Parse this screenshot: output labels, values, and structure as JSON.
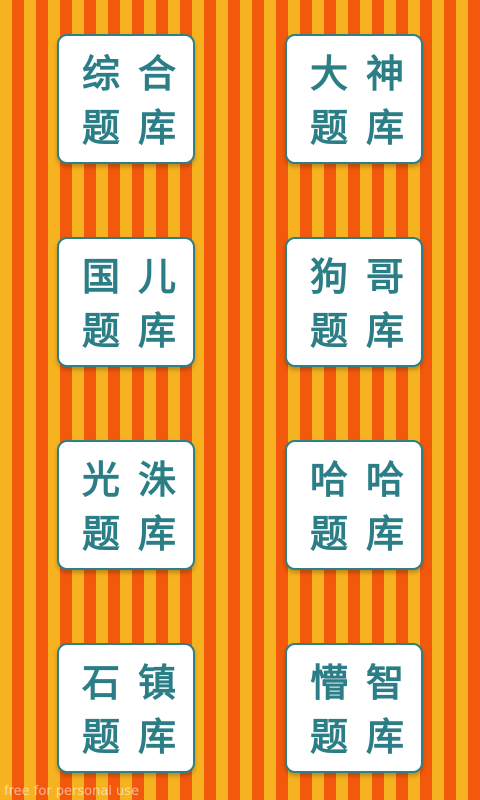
{
  "tiles": [
    {
      "line1": [
        "综",
        "合"
      ],
      "line2": [
        "题",
        "库"
      ]
    },
    {
      "line1": [
        "大",
        "神"
      ],
      "line2": [
        "题",
        "库"
      ]
    },
    {
      "line1": [
        "国",
        "儿"
      ],
      "line2": [
        "题",
        "库"
      ]
    },
    {
      "line1": [
        "狗",
        "哥"
      ],
      "line2": [
        "题",
        "库"
      ]
    },
    {
      "line1": [
        "光",
        "洙"
      ],
      "line2": [
        "题",
        "库"
      ]
    },
    {
      "line1": [
        "哈",
        "哈"
      ],
      "line2": [
        "题",
        "库"
      ]
    },
    {
      "line1": [
        "石",
        "镇"
      ],
      "line2": [
        "题",
        "库"
      ]
    },
    {
      "line1": [
        "懵",
        "智"
      ],
      "line2": [
        "题",
        "库"
      ]
    }
  ],
  "watermark": "free for personal use",
  "colors": {
    "stripe_light": "#f7b21f",
    "stripe_dark": "#f2590c",
    "tile_text": "#2c7e86",
    "tile_border": "#2f7f86"
  }
}
